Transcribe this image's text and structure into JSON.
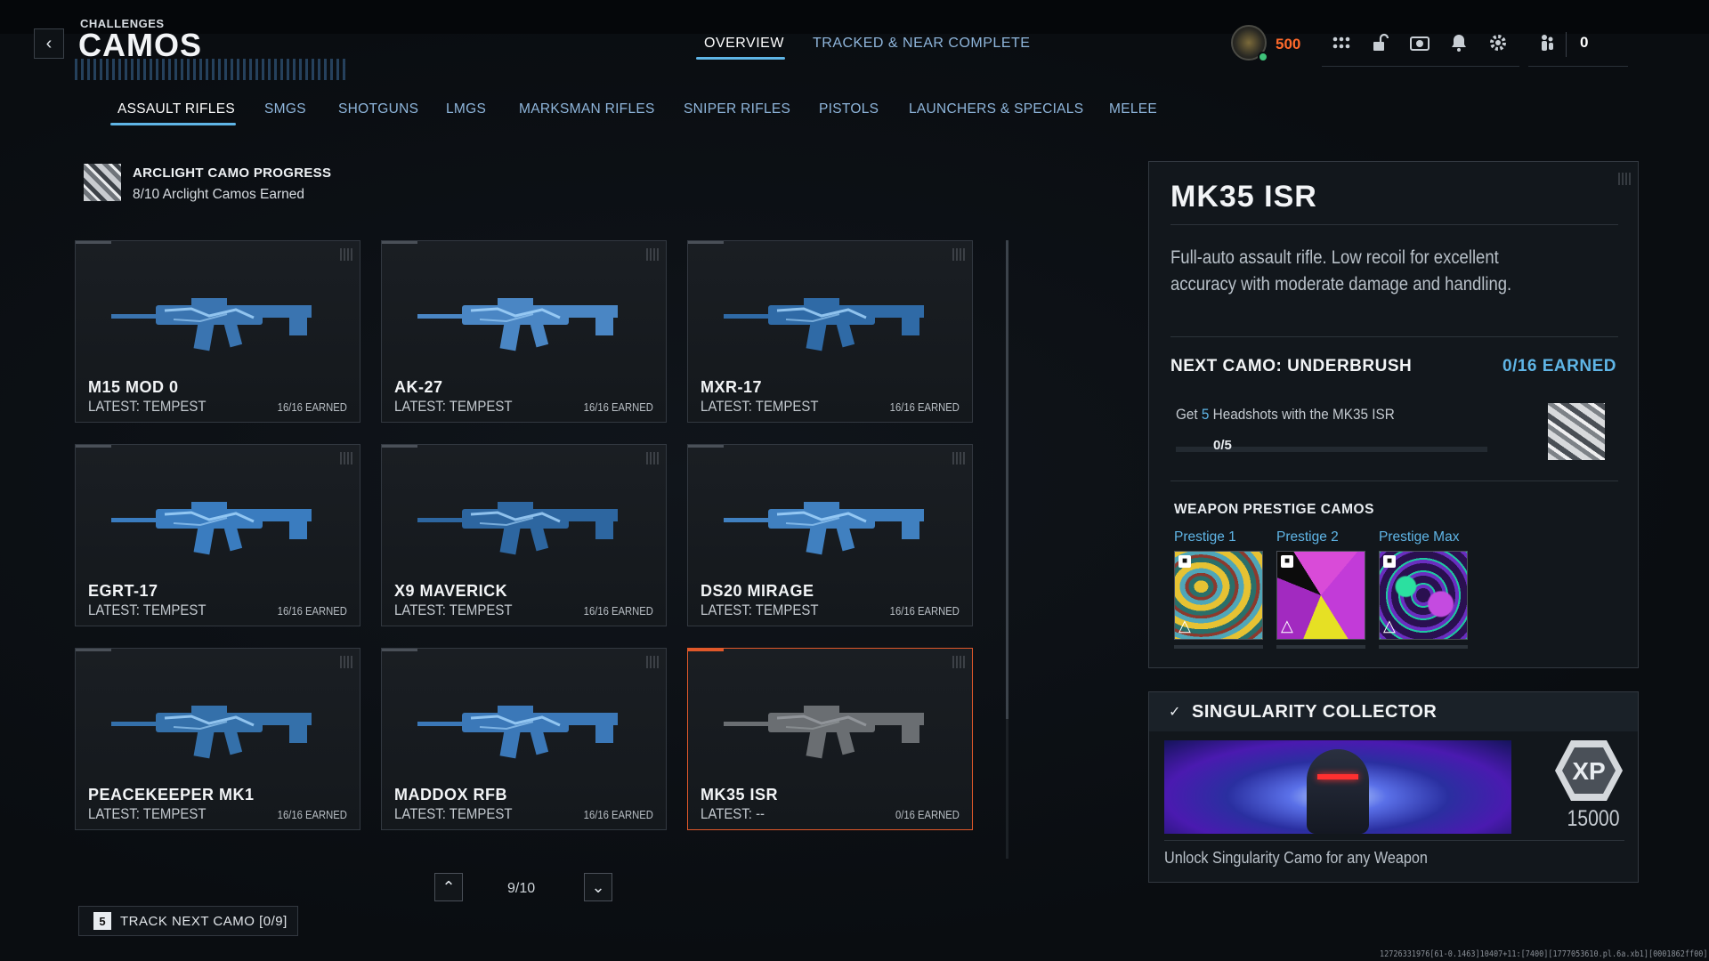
{
  "header": {
    "breadcrumb": "CHALLENGES",
    "title": "CAMOS",
    "tabs": [
      {
        "label": "OVERVIEW",
        "active": true
      },
      {
        "label": "TRACKED & NEAR COMPLETE",
        "active": false
      }
    ],
    "cod_points": "500",
    "party_count": "0",
    "icons": [
      "operator-avatar",
      "apps-grid-icon",
      "unlock-icon",
      "camera-icon",
      "bell-icon",
      "gear-icon",
      "party-icon"
    ]
  },
  "categories": [
    {
      "label": "ASSAULT RIFLES",
      "active": true
    },
    {
      "label": "SMGS"
    },
    {
      "label": "SHOTGUNS"
    },
    {
      "label": "LMGS"
    },
    {
      "label": "MARKSMAN RIFLES"
    },
    {
      "label": "SNIPER RIFLES"
    },
    {
      "label": "PISTOLS"
    },
    {
      "label": "LAUNCHERS & SPECIALS"
    },
    {
      "label": "MELEE"
    }
  ],
  "arclight": {
    "title": "ARCLIGHT CAMO PROGRESS",
    "subtitle": "8/10 Arclight Camos Earned"
  },
  "weapons": [
    {
      "name": "M15 MOD 0",
      "latest": "LATEST: TEMPEST",
      "earned": "16/16 EARNED",
      "selected": false
    },
    {
      "name": "AK-27",
      "latest": "LATEST: TEMPEST",
      "earned": "16/16 EARNED",
      "selected": false
    },
    {
      "name": "MXR-17",
      "latest": "LATEST: TEMPEST",
      "earned": "16/16 EARNED",
      "selected": false
    },
    {
      "name": "EGRT-17",
      "latest": "LATEST: TEMPEST",
      "earned": "16/16 EARNED",
      "selected": false
    },
    {
      "name": "X9 MAVERICK",
      "latest": "LATEST: TEMPEST",
      "earned": "16/16 EARNED",
      "selected": false
    },
    {
      "name": "DS20 MIRAGE",
      "latest": "LATEST: TEMPEST",
      "earned": "16/16 EARNED",
      "selected": false
    },
    {
      "name": "PEACEKEEPER MK1",
      "latest": "LATEST: TEMPEST",
      "earned": "16/16 EARNED",
      "selected": false
    },
    {
      "name": "MADDOX RFB",
      "latest": "LATEST: TEMPEST",
      "earned": "16/16 EARNED",
      "selected": false
    },
    {
      "name": "MK35 ISR",
      "latest": "LATEST: --",
      "earned": "0/16 EARNED",
      "selected": true
    }
  ],
  "pager": {
    "text": "9/10"
  },
  "track": {
    "key": "5",
    "label": "TRACK NEXT CAMO [0/9]"
  },
  "detail": {
    "name": "MK35 ISR",
    "description": "Full-auto assault rifle. Low recoil for excellent accuracy with moderate damage and handling.",
    "next_camo": "NEXT CAMO: UNDERBRUSH",
    "next_earned": "0/16 EARNED",
    "challenge_pre": "Get ",
    "challenge_num": "5",
    "challenge_post": " Headshots with the MK35 ISR",
    "progress": "0/5",
    "progress_fraction": 0,
    "prestige_title": "WEAPON PRESTIGE CAMOS",
    "prestige": [
      {
        "label": "Prestige 1"
      },
      {
        "label": "Prestige 2"
      },
      {
        "label": "Prestige Max"
      }
    ]
  },
  "reward": {
    "title": "SINGULARITY COLLECTOR",
    "xp_label": "XP",
    "xp": "15000",
    "description": "Unlock Singularity Camo for any Weapon"
  },
  "debug": "12726331976[61-0.1463]10407+11:[7400][1777053610.pl.6a.xb1][0001862ff00]",
  "colors": {
    "accent_blue": "#5fb5e6",
    "selected_border": "#e0582a",
    "cod_points": "#ff6a2b"
  }
}
